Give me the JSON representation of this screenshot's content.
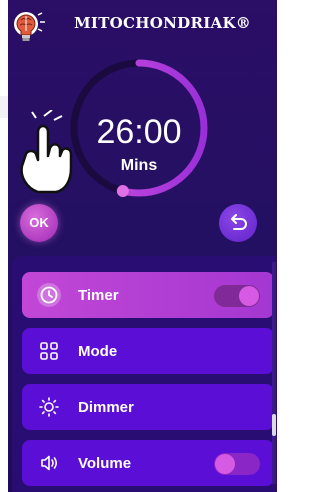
{
  "app": {
    "brand": "MITOCHONDRIAK®"
  },
  "timer": {
    "time": "26:00",
    "unit": "Mins",
    "progress_fraction": 0.54
  },
  "controls": {
    "ok_label": "OK"
  },
  "menu": {
    "items": [
      {
        "label": "Timer",
        "icon": "clock-icon",
        "active": true,
        "toggle": "on"
      },
      {
        "label": "Mode",
        "icon": "grid-icon",
        "active": false
      },
      {
        "label": "Dimmer",
        "icon": "sun-icon",
        "active": false
      },
      {
        "label": "Volume",
        "icon": "speaker-icon",
        "active": false,
        "toggle": "off"
      }
    ]
  },
  "colors": {
    "background": "#241063",
    "accent": "#c247d6",
    "menu_item": "#5b0fd6",
    "dial_track": "#1a0a40"
  }
}
